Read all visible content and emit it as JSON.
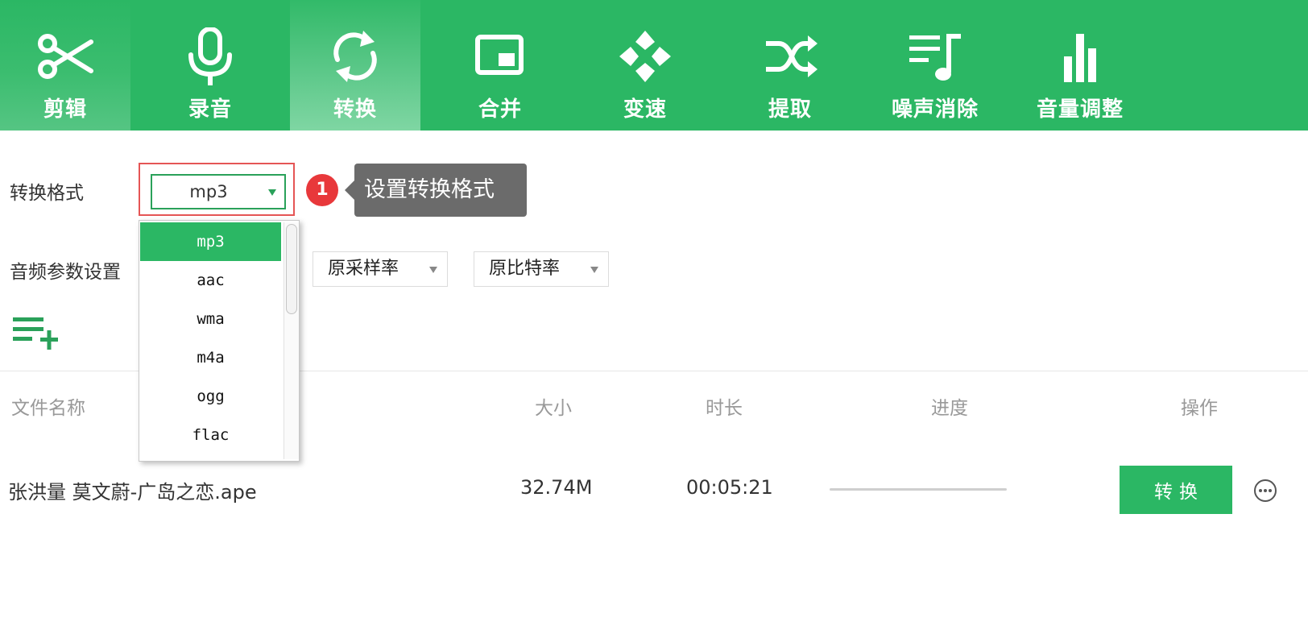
{
  "toolbar": {
    "tools": [
      {
        "label": "剪辑",
        "icon": "scissors-icon"
      },
      {
        "label": "录音",
        "icon": "microphone-icon"
      },
      {
        "label": "转换",
        "icon": "convert-icon"
      },
      {
        "label": "合并",
        "icon": "merge-icon"
      },
      {
        "label": "变速",
        "icon": "speed-icon"
      },
      {
        "label": "提取",
        "icon": "shuffle-icon"
      },
      {
        "label": "噪声消除",
        "icon": "noise-icon"
      },
      {
        "label": "音量调整",
        "icon": "volume-bars-icon"
      }
    ],
    "active": "转换"
  },
  "format": {
    "label": "转换格式",
    "selected": "mp3",
    "options": [
      "mp3",
      "aac",
      "wma",
      "m4a",
      "ogg",
      "flac"
    ]
  },
  "guide": {
    "step": "1",
    "text": "设置转换格式"
  },
  "audio_params": {
    "label": "音频参数设置",
    "sample_rate": "原采样率",
    "bit_rate": "原比特率"
  },
  "list": {
    "headers": {
      "name": "文件名称",
      "size": "大小",
      "duration": "时长",
      "progress": "进度",
      "action": "操作"
    },
    "rows": [
      {
        "name": "张洪量 莫文蔚-广岛之恋.ape",
        "size": "32.74M",
        "duration": "00:05:21",
        "progress": 0,
        "action_label": "转换"
      }
    ]
  },
  "colors": {
    "brand_green": "#2bb764",
    "highlight_red": "#e55555",
    "badge_red": "#e8383b",
    "tooltip_gray": "#6b6b6b"
  }
}
